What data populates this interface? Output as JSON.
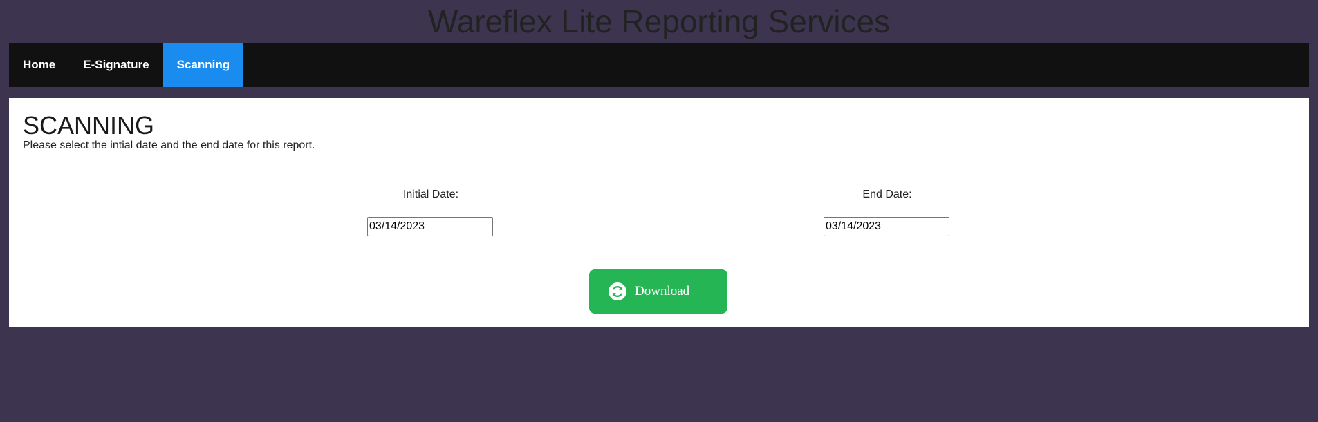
{
  "header": {
    "title": "Wareflex Lite Reporting Services"
  },
  "nav": {
    "items": [
      {
        "label": "Home",
        "active": false
      },
      {
        "label": "E-Signature",
        "active": false
      },
      {
        "label": "Scanning",
        "active": true
      }
    ]
  },
  "main": {
    "title": "SCANNING",
    "description": "Please select the intial date and the end date for this report.",
    "initial_date": {
      "label": "Initial Date:",
      "value": "03/14/2023"
    },
    "end_date": {
      "label": "End Date:",
      "value": "03/14/2023"
    },
    "download_button": {
      "label": "Download",
      "icon": "refresh-icon"
    }
  },
  "colors": {
    "background": "#3d3550",
    "nav_bar": "#111111",
    "nav_active": "#1a8cf0",
    "download_button": "#26b555"
  }
}
